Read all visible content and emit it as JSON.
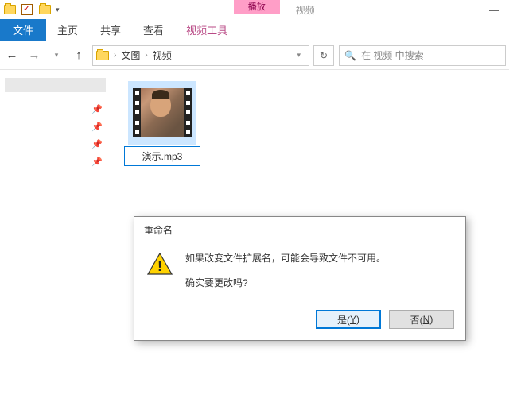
{
  "titlebar": {
    "context_header": "播放",
    "context_label": "视频"
  },
  "ribbon": {
    "file": "文件",
    "home": "主页",
    "share": "共享",
    "view": "查看",
    "video_tools": "视频工具"
  },
  "nav": {
    "seg1": "文图",
    "seg2": "视频"
  },
  "search": {
    "placeholder": "在 视频 中搜索"
  },
  "file": {
    "name": "演示.mp3"
  },
  "dialog": {
    "title": "重命名",
    "line1": "如果改变文件扩展名，可能会导致文件不可用。",
    "line2": "确实要更改吗?",
    "yes_prefix": "是(",
    "yes_key": "Y",
    "yes_suffix": ")",
    "no_prefix": "否(",
    "no_key": "N",
    "no_suffix": ")"
  }
}
